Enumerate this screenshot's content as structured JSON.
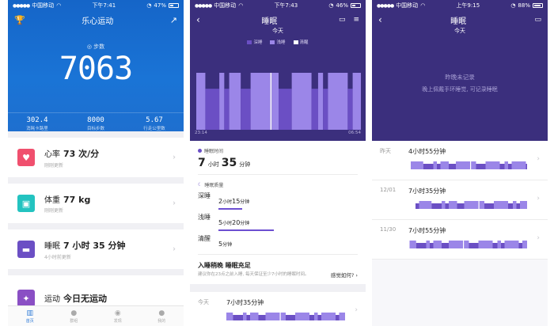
{
  "status": {
    "carrier": "中国移动",
    "p1_time": "下午7:41",
    "p1_battery": "47%",
    "p1_battery_level": 0.47,
    "p2_time": "下午7:43",
    "p2_battery": "46%",
    "p2_battery_level": 0.46,
    "p3_time": "上午9:15",
    "p3_battery": "88%",
    "p3_battery_level": 0.88
  },
  "p1": {
    "title": "乐心运动",
    "steps_label": "步数",
    "steps": "7063",
    "stats": [
      {
        "value": "302.4",
        "label": "消耗卡路里"
      },
      {
        "value": "8000",
        "label": "目标步数"
      },
      {
        "value": "5.67",
        "label": "行走公里数"
      }
    ],
    "cards": [
      {
        "title": "心率",
        "value": "73 次/分",
        "sub": "刚刚更新",
        "color": "#f0506e",
        "icon": "heart-icon"
      },
      {
        "title": "体重",
        "value": "77 kg",
        "sub": "刚刚更新",
        "color": "#23c3c0",
        "icon": "scale-icon"
      },
      {
        "title": "睡眠",
        "value": "7 小时 35 分钟",
        "sub": "4小时前更新",
        "color": "#6b4fc4",
        "icon": "bed-icon"
      },
      {
        "title": "运动",
        "value": "今日无运动",
        "sub": "",
        "color": "#8a4fc4",
        "icon": "run-icon"
      }
    ],
    "tabs": [
      {
        "label": "首页",
        "icon": "chart-icon"
      },
      {
        "label": "群组",
        "icon": "group-icon"
      },
      {
        "label": "发现",
        "icon": "compass-icon"
      },
      {
        "label": "我的",
        "icon": "person-icon"
      }
    ]
  },
  "p2": {
    "title": "睡眠",
    "subtitle": "今天",
    "legend": [
      "深睡",
      "浅睡",
      "清醒"
    ],
    "colors": {
      "deep": "#6b4fc4",
      "light": "#9b86e8",
      "awake": "#ffffff",
      "bg": "#3b2f7d"
    },
    "start_time": "23:14",
    "end_time": "06:54",
    "sleep_time_label": "睡眠时间",
    "total_hours": "7",
    "hour_unit": "小时",
    "total_minutes": "35",
    "minute_unit": "分钟",
    "quality_label": "睡眠质量",
    "quality": [
      {
        "label": "深睡",
        "hours": "2",
        "minutes": "15",
        "fraction": 0.3
      },
      {
        "label": "浅睡",
        "hours": "5",
        "minutes": "20",
        "fraction": 0.7
      },
      {
        "label": "清醒",
        "hours": "",
        "minutes": "5",
        "fraction": 0
      }
    ],
    "advice_title": "入睡稍晚  睡眠充足",
    "advice_desc": "建议你在23点之前入睡, 每天保证至少7小时的睡眠时间。",
    "advice_ask": "感觉如何?",
    "today_label": "今天",
    "today_value": "7小时35分钟"
  },
  "p3": {
    "title": "睡眠",
    "subtitle": "今天",
    "no_record": "昨晚未记录",
    "hint": "晚上佩戴手环睡觉, 可记录睡眠",
    "history": [
      {
        "date": "昨天",
        "value": "4小时55分钟"
      },
      {
        "date": "12/01",
        "value": "7小时35分钟"
      },
      {
        "date": "11/30",
        "value": "7小时55分钟"
      }
    ]
  },
  "chart_data": {
    "type": "bar",
    "title": "",
    "series": [
      {
        "name": "深睡",
        "color": "#6b4fc4"
      },
      {
        "name": "浅睡",
        "color": "#9b86e8"
      },
      {
        "name": "清醒",
        "color": "#ffffff"
      }
    ],
    "x_start": "23:14",
    "x_end": "06:54",
    "segments": [
      {
        "stage": "light",
        "start": 0.0,
        "end": 0.055
      },
      {
        "stage": "deep",
        "start": 0.055,
        "end": 0.14
      },
      {
        "stage": "light",
        "start": 0.14,
        "end": 0.17
      },
      {
        "stage": "deep",
        "start": 0.17,
        "end": 0.2
      },
      {
        "stage": "light",
        "start": 0.2,
        "end": 0.27
      },
      {
        "stage": "deep",
        "start": 0.27,
        "end": 0.33
      },
      {
        "stage": "light",
        "start": 0.33,
        "end": 0.45
      },
      {
        "stage": "awake",
        "start": 0.45,
        "end": 0.458
      },
      {
        "stage": "light",
        "start": 0.458,
        "end": 0.5
      },
      {
        "stage": "deep",
        "start": 0.5,
        "end": 0.58
      },
      {
        "stage": "light",
        "start": 0.58,
        "end": 0.7
      },
      {
        "stage": "deep",
        "start": 0.7,
        "end": 0.74
      },
      {
        "stage": "light",
        "start": 0.74,
        "end": 0.77
      },
      {
        "stage": "deep",
        "start": 0.77,
        "end": 0.8
      },
      {
        "stage": "light",
        "start": 0.8,
        "end": 0.92
      },
      {
        "stage": "deep",
        "start": 0.92,
        "end": 0.95
      },
      {
        "stage": "light",
        "start": 0.95,
        "end": 1.0
      }
    ]
  }
}
